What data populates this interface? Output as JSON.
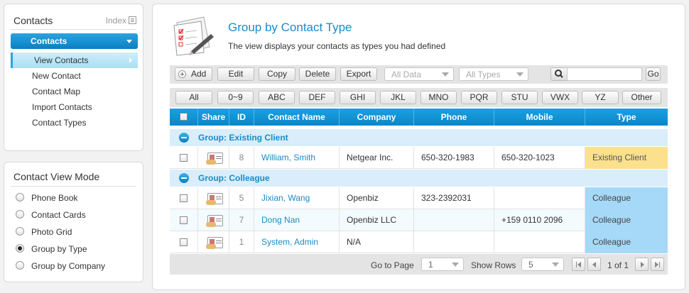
{
  "sidebar": {
    "title": "Contacts",
    "index_label": "Index",
    "active_menu": "Contacts",
    "items": [
      {
        "label": "View Contacts",
        "selected": true
      },
      {
        "label": "New Contact",
        "selected": false
      },
      {
        "label": "Contact Map",
        "selected": false
      },
      {
        "label": "Import Contacts",
        "selected": false
      },
      {
        "label": "Contact Types",
        "selected": false
      }
    ]
  },
  "view_mode": {
    "title": "Contact View Mode",
    "options": [
      {
        "label": "Phone Book",
        "checked": false
      },
      {
        "label": "Contact Cards",
        "checked": false
      },
      {
        "label": "Photo Grid",
        "checked": false
      },
      {
        "label": "Group by Type",
        "checked": true
      },
      {
        "label": "Group by Company",
        "checked": false
      }
    ]
  },
  "main": {
    "title": "Group by Contact Type",
    "subtitle": "The view displays your contacts as types you had defined",
    "icon": "clipboard-pen-icon"
  },
  "toolbar": {
    "add_label": "Add",
    "edit_label": "Edit",
    "copy_label": "Copy",
    "delete_label": "Delete",
    "export_label": "Export",
    "data_filter": "All Data",
    "type_filter": "All Types",
    "search_placeholder": "",
    "go_label": "Go"
  },
  "alphabet": [
    "All",
    "0~9",
    "ABC",
    "DEF",
    "GHI",
    "JKL",
    "MNO",
    "PQR",
    "STU",
    "VWX",
    "YZ",
    "Other"
  ],
  "grid": {
    "columns": [
      "Share",
      "ID",
      "Contact Name",
      "Company",
      "Phone",
      "Mobile",
      "Type"
    ],
    "groups": [
      {
        "label": "Group: Existing Client",
        "rows": [
          {
            "id": "8",
            "name": "William, Smith",
            "company": "Netgear Inc.",
            "phone": "650-320-1983",
            "mobile": "650-320-1023",
            "type": "Existing Client"
          }
        ]
      },
      {
        "label": "Group: Colleague",
        "rows": [
          {
            "id": "5",
            "name": "Jixian, Wang",
            "company": "Openbiz",
            "phone": "323-2392031",
            "mobile": "",
            "type": "Colleague"
          },
          {
            "id": "7",
            "name": "Dong Nan",
            "company": "Openbiz LLC",
            "phone": "",
            "mobile": "+159 0110 2096",
            "type": "Colleague"
          },
          {
            "id": "1",
            "name": "System, Admin",
            "company": "N/A",
            "phone": "",
            "mobile": "",
            "type": "Colleague"
          }
        ]
      }
    ]
  },
  "pager": {
    "goto_label": "Go to Page",
    "page_value": "1",
    "rows_label": "Show Rows",
    "rows_value": "5",
    "page_info": "1 of 1"
  },
  "colors": {
    "accent": "#1a8ac9",
    "header_blue": "#0a86c8",
    "existing_client": "#fbe08e",
    "colleague": "#a6d8f8"
  }
}
